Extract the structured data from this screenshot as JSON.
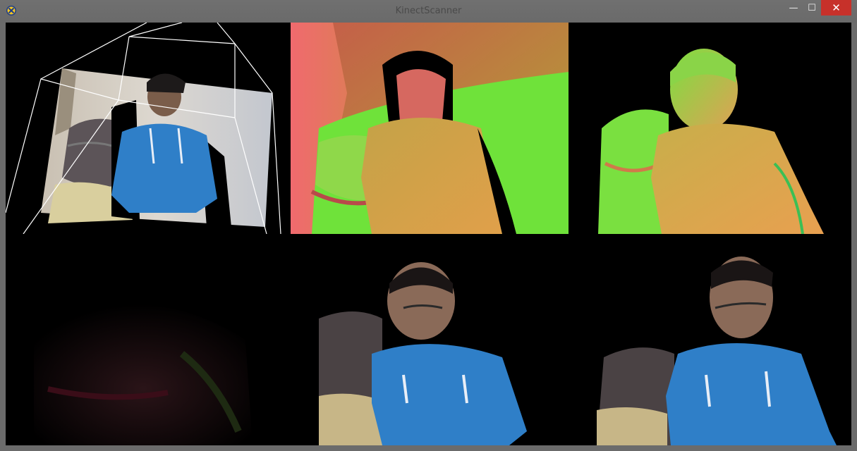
{
  "window": {
    "title": "KinectScanner",
    "icon": "kinect-app-icon",
    "controls": {
      "minimize": "—",
      "maximize": "☐",
      "close": "✕"
    }
  },
  "colors": {
    "titlebar": "#6d6d6d",
    "close_button": "#c7312a",
    "viewport_background": "#000000",
    "frustum_lines": "#ffffff",
    "normal_map_red": "#e0605a",
    "normal_map_green": "#6fe23a",
    "normal_map_orange": "#d9a04a",
    "shirt_blue": "#2f7fc8"
  },
  "views": [
    {
      "id": "camera-frustum-view",
      "content": "3D point cloud with camera frustum"
    },
    {
      "id": "depth-normal-view",
      "content": "depth normals map"
    },
    {
      "id": "model-normal-view",
      "content": "reconstructed model normals"
    },
    {
      "id": "dark-color-view",
      "content": "dim color residual"
    },
    {
      "id": "textured-model-view",
      "content": "textured reconstruction front"
    },
    {
      "id": "textured-model-side-view",
      "content": "textured reconstruction side"
    }
  ]
}
